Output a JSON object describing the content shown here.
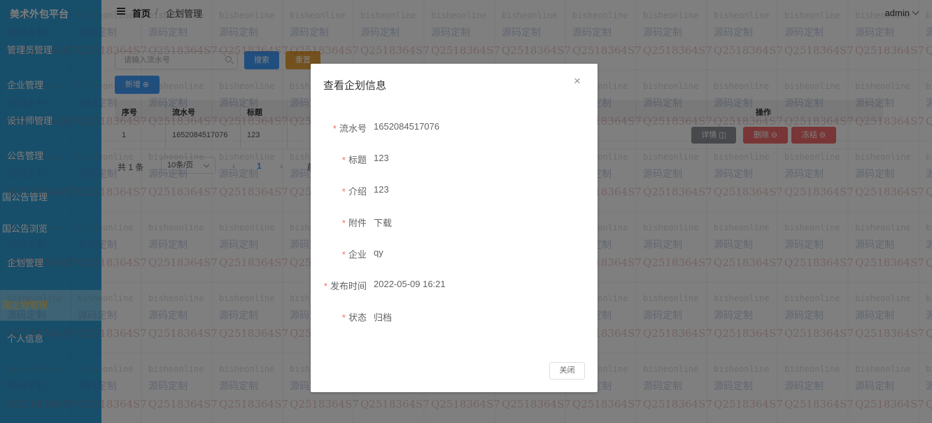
{
  "sidebar": {
    "brand": "美术外包平台",
    "items": [
      {
        "label": "管理员管理"
      },
      {
        "label": "企业管理"
      },
      {
        "label": "设计师管理"
      },
      {
        "label": "公告管理"
      },
      {
        "label": "国公告管理"
      },
      {
        "label": "国公告浏览"
      },
      {
        "label": "企划管理"
      },
      {
        "label": "国企划管理"
      },
      {
        "label": "个人信息"
      }
    ],
    "accent": "#2f9fd6"
  },
  "header": {
    "breadcrumb_home": "首页",
    "breadcrumb_sep": "/",
    "breadcrumb_current": "企划管理",
    "user": "admin"
  },
  "toolbar": {
    "search_placeholder": "请输入流水号",
    "search_label": "搜索",
    "reset_label": "重置",
    "add_label": "新增 ⊕"
  },
  "table": {
    "headers": [
      "序号",
      "流水号",
      "标题",
      "操作"
    ],
    "rows": [
      {
        "index": "1",
        "serial": "1652084517076",
        "title": "123"
      }
    ],
    "actions": {
      "detail": "详情 ◫",
      "delete": "删除 ⊖",
      "freeze": "冻结 ⊖"
    }
  },
  "pagination": {
    "total": "共 1 条",
    "page_size": "10条/页",
    "prev": "‹",
    "current": "1",
    "next": "›",
    "goto": "前"
  },
  "watermark": {
    "line1": "bisheonline",
    "line2": "源码定制",
    "line3": "Q2518364S7"
  },
  "dialog": {
    "title": "查看企划信息",
    "close_icon": "×",
    "fields": [
      {
        "label": "流水号",
        "value": "1652084517076"
      },
      {
        "label": "标题",
        "value": "123"
      },
      {
        "label": "介绍",
        "value": "123"
      },
      {
        "label": "附件",
        "value": "下载"
      },
      {
        "label": "企业",
        "value": "qy"
      },
      {
        "label": "发布时间",
        "value": "2022-05-09 16:21"
      },
      {
        "label": "状态",
        "value": "归档"
      }
    ],
    "close_button": "关闭"
  }
}
